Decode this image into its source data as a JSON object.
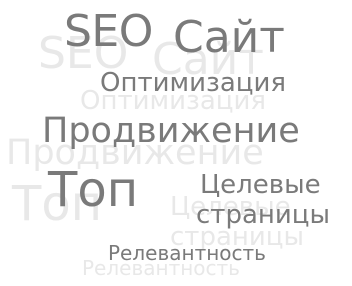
{
  "tag_cloud": {
    "words": {
      "seo": "SEO",
      "sajt": "Сайт",
      "optimizacija": "Оптимизация",
      "prodvizhenie": "Продвижение",
      "top": "Топ",
      "celevye": "Целевые",
      "stranicy": "страницы",
      "relevantnost": "Релевантность"
    },
    "colors": {
      "text": "#7a7a7a",
      "reflection": "#e8e8e8",
      "background": "#ffffff"
    }
  }
}
